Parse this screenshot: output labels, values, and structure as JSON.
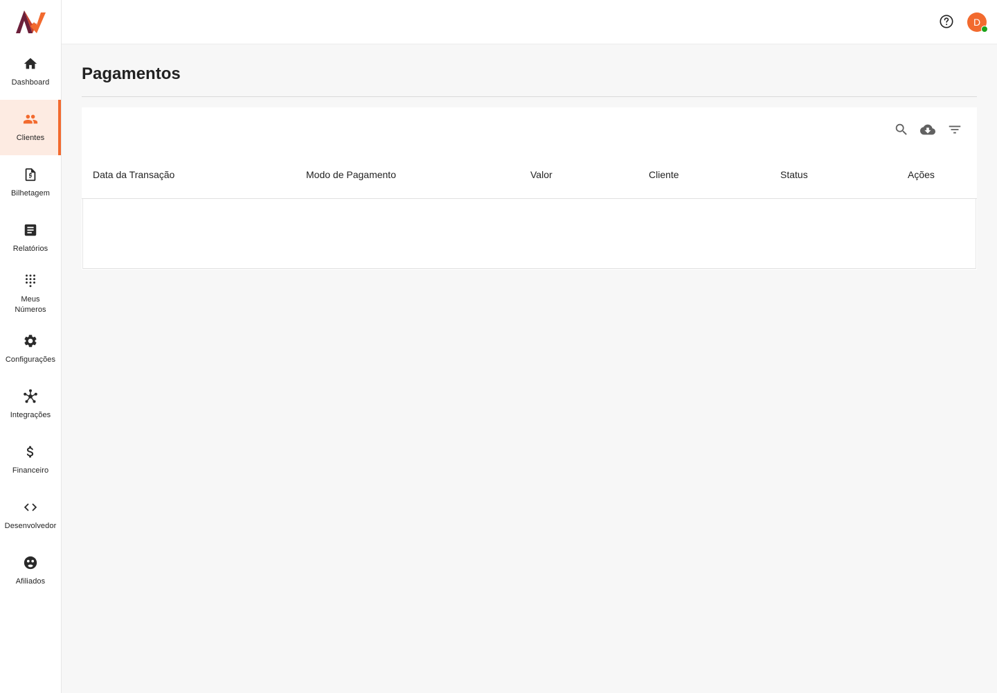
{
  "sidebar": {
    "items": [
      {
        "label": "Dashboard",
        "icon": "home-icon"
      },
      {
        "label": "Clientes",
        "icon": "people-icon",
        "active": true
      },
      {
        "label": "Bilhetagem",
        "icon": "receipt-icon"
      },
      {
        "label": "Relatórios",
        "icon": "document-icon"
      },
      {
        "label": "Meus Números",
        "icon": "dialpad-icon"
      },
      {
        "label": "Configurações",
        "icon": "gear-icon"
      },
      {
        "label": "Integrações",
        "icon": "hub-icon"
      },
      {
        "label": "Financeiro",
        "icon": "dollar-icon"
      },
      {
        "label": "Desenvolvedor",
        "icon": "code-icon"
      },
      {
        "label": "Afiliados",
        "icon": "affiliate-icon"
      }
    ]
  },
  "header": {
    "avatar_initial": "D",
    "avatar_color": "#f26a2e",
    "status_color": "#1aa31a"
  },
  "page": {
    "title": "Pagamentos"
  },
  "table": {
    "toolbar": [
      "search-icon",
      "cloud-download-icon",
      "filter-icon"
    ],
    "columns": [
      "Data da Transação",
      "Modo de Pagamento",
      "Valor",
      "Cliente",
      "Status",
      "Ações"
    ],
    "rows": []
  },
  "colors": {
    "accent": "#f26a2e",
    "active_bg": "#fdebe2",
    "background": "#f7f7f7"
  }
}
